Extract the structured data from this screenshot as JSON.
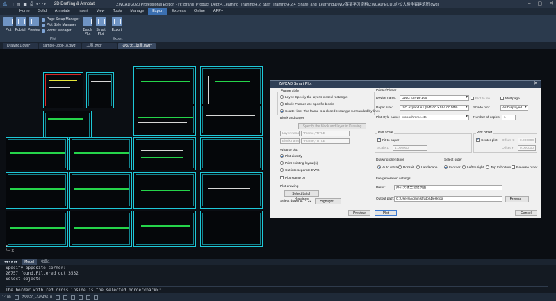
{
  "app": {
    "workspace": "2D Drafting & Annotati",
    "window_title": "ZWCAD 2020 Professional Edition - [Y:\\Brand_Product_Dept\\4.Learning_Training\\4.2_Staff_Training\\4.2.4_Share_and_Learning\\DWG\\某某学习资料\\ZWCAD\\ECUD办公大楼全套建筑图.dwg]"
  },
  "menu": {
    "tabs": [
      "Home",
      "Solid",
      "Annotate",
      "Insert",
      "View",
      "Tools",
      "Manage",
      "Export",
      "Express",
      "Online",
      "APP+"
    ],
    "active": "Export"
  },
  "ribbon": {
    "buttons": [
      "Plot",
      "Publish",
      "Preview",
      "Batch Plot",
      "Smart Plot",
      "Export"
    ],
    "small_items": [
      "Page Setup Manager",
      "Plot Style Manager",
      "Plotter Manager"
    ],
    "groups": [
      "Plot",
      "Export"
    ]
  },
  "doc_tabs": [
    "Drawing1.dwg*",
    "sample-Door-18.dwg*",
    "工图.dwg*",
    "办公大...筑图.dwg*"
  ],
  "dialog": {
    "title": "ZWCAD Smart Plot",
    "frame_style": {
      "label": "Frame style",
      "options": [
        "Layer: Specify the layer's closed rectangle",
        "Block: Frames are specific blocks",
        "Scatter line: The frame is a closed rectangle surrounded by lines"
      ],
      "selected": 2
    },
    "block_and_layer": {
      "label": "Block and Layer",
      "specify_btn": "Specify the block and layer in Drawing",
      "layer_name_label": "Layer name",
      "layer_name_value": "*Frame,*TITLE",
      "block_name_label": "Block name",
      "block_name_value": "*Frame,*TITLE"
    },
    "what_to_plot": {
      "label": "What to plot",
      "options": [
        "Plot directly",
        "Print existing layout(s)",
        "Cut into separate DWG"
      ],
      "selected": 0,
      "stamp_label": "Plot stamp on"
    },
    "plot_drawing": {
      "label": "Plot drawing",
      "batch_btn": "Select batch drawings",
      "select_drawing_label": "Select drawing:",
      "select_drawing_count": "22",
      "highlight_btn": "Highlight..."
    },
    "printer": {
      "label": "Printer/Plotter",
      "device_label": "Device name:",
      "device_value": "DWG to PDF.pc5",
      "plot_to_file": "Plot to file",
      "multipage": "Multipage",
      "paper_label": "Paper size:",
      "paper_value": "ISO expand A1 (841.00 x 594.00 MM)",
      "shade_label": "Shade plot:",
      "shade_value": "As Displayed",
      "style_label": "Plot style name:",
      "style_value": "Monochrome.ctb",
      "copies_label": "Number of copies:",
      "copies_value": "1"
    },
    "plot_scale": {
      "label": "Plot scale",
      "fit_label": "Fit to paper",
      "scale_label": "Scale 1:",
      "scale_value": "1.000000"
    },
    "plot_offset": {
      "label": "Plot offset",
      "center_label": "Center plot",
      "x_label": "Offset X:",
      "x_value": "0.000000",
      "y_label": "Offset Y:",
      "y_value": "0.000000"
    },
    "orientation": {
      "label": "Drawing orientation",
      "options": [
        "Auto rotate",
        "Portrait",
        "Landscape"
      ],
      "selected": 0
    },
    "order": {
      "label": "Select order",
      "options": [
        "In order",
        "Left to right",
        "Top to bottom"
      ],
      "selected": 0,
      "reverse_label": "Reverse order"
    },
    "file_gen": {
      "label": "File generation settings",
      "prefix_label": "Prefix:",
      "prefix_value": "办公大楼全套建筑图",
      "output_label": "Output path:",
      "output_value": "C:\\Users\\Administrator\\Desktop",
      "browse_btn": "Browse..."
    },
    "preview_btn": "Preview",
    "plot_btn": "Plot",
    "cancel_btn": "Cancel"
  },
  "cmd_tabs": [
    "Model",
    "布局1"
  ],
  "command_lines": [
    "Specify opposite corner:",
    "20757 found,Filtered out 3532",
    "Select objects:",
    "The border with red cross inside is the selected border<back>:"
  ],
  "status": {
    "scale": "1:100",
    "coords": "753520, -145436, 0"
  },
  "colors": {
    "sheet_border": "#1ec8d8",
    "accent": "#3b6fb0"
  }
}
